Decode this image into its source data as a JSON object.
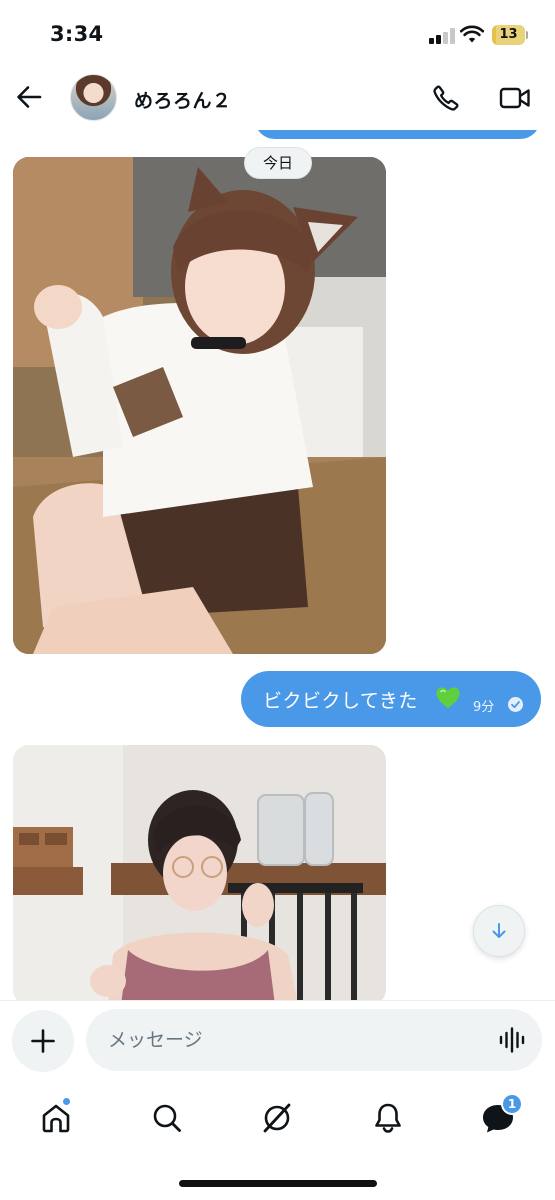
{
  "status_bar": {
    "time": "3:34",
    "battery_level": "13",
    "battery_percent": 13,
    "battery_color": "#e2c24c",
    "signal_bars_active": 2,
    "signal_bars_total": 4
  },
  "header": {
    "contact_name": "めろろん２",
    "icons": [
      "arrow-left-icon",
      "phone-icon",
      "video-camera-icon"
    ]
  },
  "chat": {
    "date_separator": "今日",
    "messages": [
      {
        "type": "image",
        "direction": "incoming"
      },
      {
        "type": "text",
        "direction": "outgoing",
        "text": "ビクビクしてきた",
        "emoji": "green-heart",
        "time": "9分",
        "status": "sent"
      },
      {
        "type": "image",
        "direction": "incoming"
      }
    ]
  },
  "composer": {
    "placeholder": "メッセージ"
  },
  "nav": {
    "items": [
      {
        "name": "home",
        "icon": "home-icon",
        "has_dot": true
      },
      {
        "name": "search",
        "icon": "search-icon"
      },
      {
        "name": "grok",
        "icon": "grok-icon"
      },
      {
        "name": "notifications",
        "icon": "bell-icon"
      },
      {
        "name": "messages",
        "icon": "envelope-bubble-icon",
        "badge": "1"
      }
    ]
  },
  "colors": {
    "accent": "#4a99e9",
    "input_bg": "#eff3f4",
    "text": "#0f1419",
    "placeholder": "#687684"
  }
}
